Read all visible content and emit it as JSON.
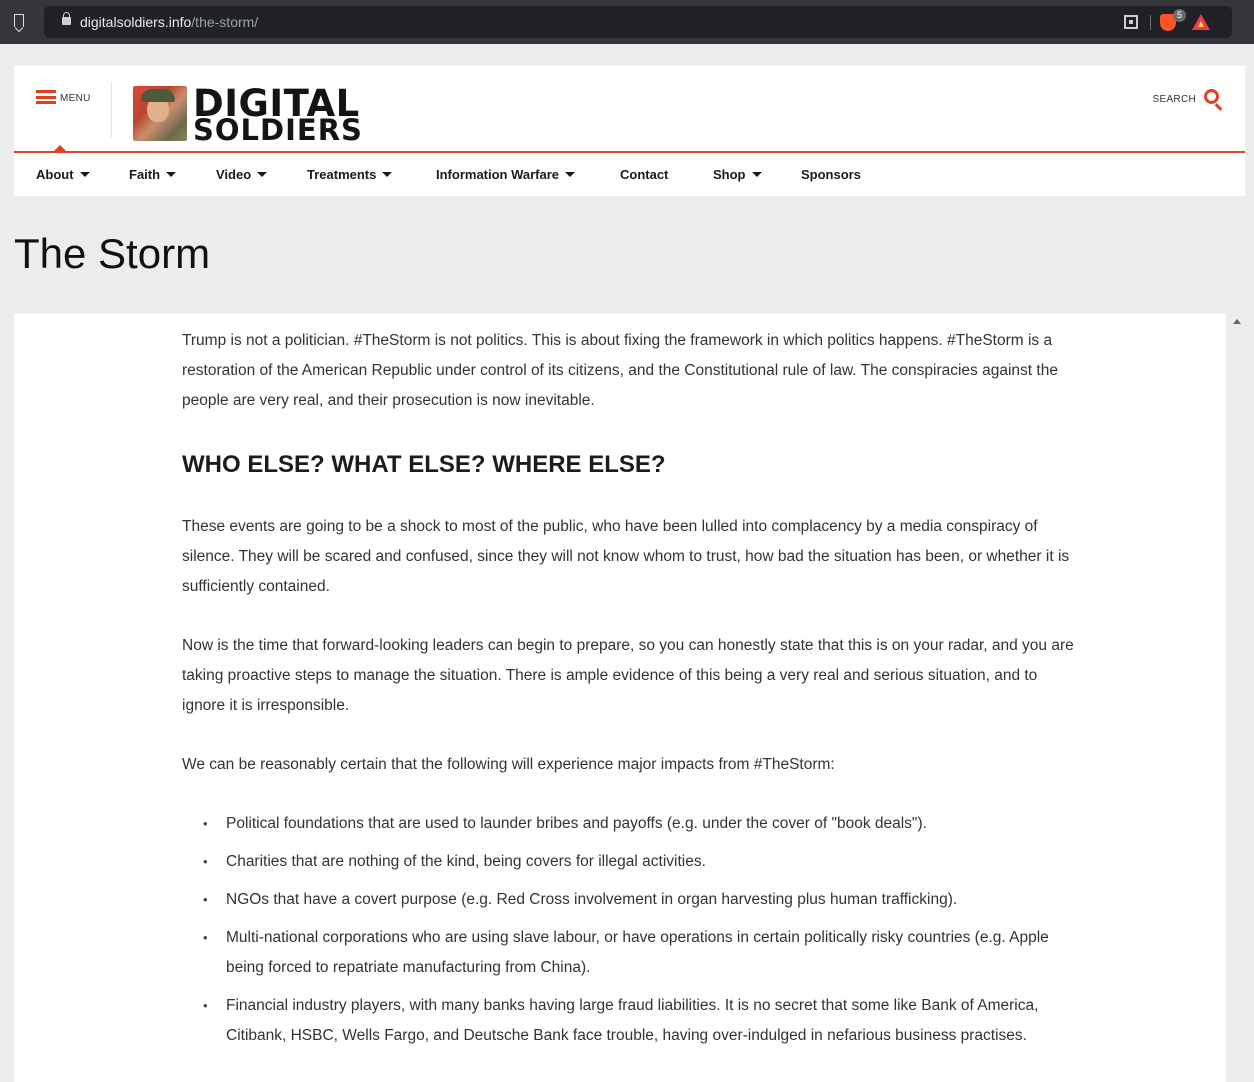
{
  "browser": {
    "url_domain": "digitalsoldiers.info",
    "url_path": "/the-storm/",
    "extension_badge": "5",
    "icons": [
      "bookmark-icon",
      "lock-icon",
      "qr-code-icon",
      "brave-shields-icon",
      "brave-rewards-icon"
    ]
  },
  "header": {
    "menu_label": "MENU",
    "logo_line1": "DIGITAL",
    "logo_line2": "SOLDIERS",
    "search_label": "SEARCH",
    "accent_color": "#e2401c"
  },
  "nav": {
    "items": [
      {
        "label": "About",
        "has_dropdown": true
      },
      {
        "label": "Faith",
        "has_dropdown": true
      },
      {
        "label": "Video",
        "has_dropdown": true
      },
      {
        "label": "Treatments",
        "has_dropdown": true
      },
      {
        "label": "Information Warfare",
        "has_dropdown": true
      },
      {
        "label": "Contact",
        "has_dropdown": false
      },
      {
        "label": "Shop",
        "has_dropdown": true
      },
      {
        "label": "Sponsors",
        "has_dropdown": false
      }
    ]
  },
  "page": {
    "title": "The Storm"
  },
  "article": {
    "intro": "Trump is not a politician. #TheStorm is not politics. This is about fixing the framework in which politics happens. #TheStorm is a restoration of the American Republic under control of its citizens, and the Constitutional rule of law. The conspiracies against the people are very real, and their prosecution is now inevitable.",
    "heading": "WHO ELSE? WHAT ELSE? WHERE ELSE?",
    "paragraphs": [
      "These events are going to be a shock to most of the public, who have been lulled into complacency by a media conspiracy of silence. They will be scared and confused, since they will not know whom to trust, how bad the situation has been, or whether it is sufficiently contained.",
      "Now is the time that forward-looking leaders can begin to prepare, so you can honestly state that this is on your radar, and you are taking proactive steps to manage the situation. There is ample evidence of this being a very real and serious situation, and to ignore it is irresponsible.",
      "We can be reasonably certain that the following will experience major impacts from #TheStorm:"
    ],
    "list": [
      "Political foundations that are used to launder bribes and payoffs (e.g. under the cover of \"book deals\").",
      "Charities that are nothing of the kind, being covers for illegal activities.",
      "NGOs that have a covert purpose (e.g. Red Cross involvement in organ harvesting plus human trafficking).",
      "Multi-national corporations who are using slave labour, or have operations in certain politically risky countries (e.g. Apple being forced to repatriate manufacturing from China).",
      "Financial industry players, with many banks having large fraud liabilities. It is no secret that some like Bank of America, Citibank, HSBC, Wells Fargo, and Deutsche Bank face trouble, having over-indulged in nefarious business practises."
    ]
  }
}
